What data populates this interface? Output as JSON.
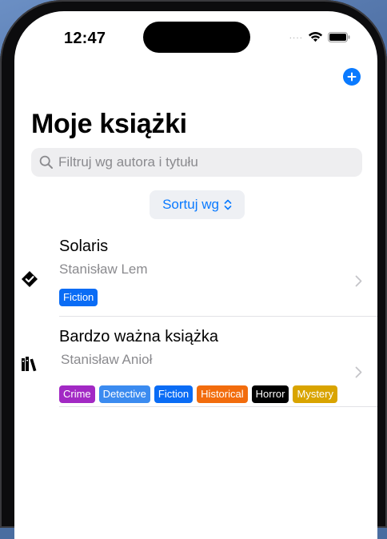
{
  "status_bar": {
    "time": "12:47"
  },
  "header": {
    "title": "Moje książki"
  },
  "search": {
    "placeholder": "Filtruj wg autora i tytułu",
    "value": ""
  },
  "sort": {
    "label": "Sortuj wg"
  },
  "books": [
    {
      "title": "Solaris",
      "author": "Stanisław Lem",
      "status_icon": "checkmark-seal-icon",
      "tags": [
        {
          "label": "Fiction",
          "color": "#0a6cf5"
        }
      ]
    },
    {
      "title": "Bardzo ważna książka",
      "author": "Stanisław Anioł",
      "status_icon": "books-stack-icon",
      "tags": [
        {
          "label": "Crime",
          "color": "#a229c4"
        },
        {
          "label": "Detective",
          "color": "#3b8bf0"
        },
        {
          "label": "Fiction",
          "color": "#0a6cf5"
        },
        {
          "label": "Historical",
          "color": "#f26c0d"
        },
        {
          "label": "Horror",
          "color": "#000000"
        },
        {
          "label": "Mystery",
          "color": "#d9a400"
        }
      ]
    }
  ],
  "colors": {
    "accent": "#0a7aff",
    "secondary_text": "#8a8a8e",
    "search_bg": "#eeeef0"
  }
}
